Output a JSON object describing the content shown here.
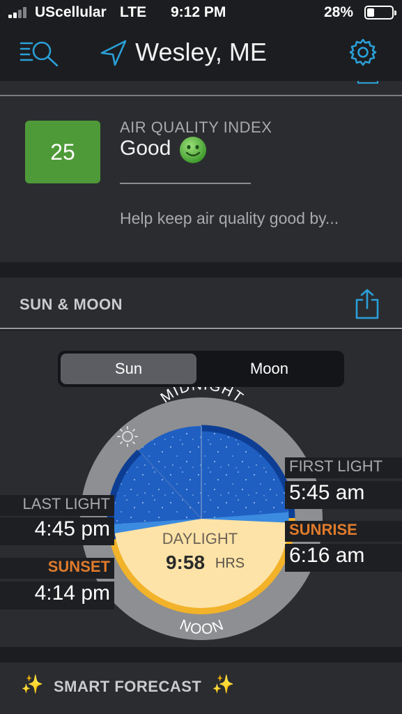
{
  "status_bar": {
    "carrier": "UScellular",
    "network": "LTE",
    "time": "9:12 PM",
    "battery": "28%",
    "battery_level": 0.28
  },
  "nav": {
    "title": "Wesley, ME",
    "icons": [
      "search-menu-icon",
      "location-arrow-icon",
      "gear-icon"
    ],
    "accent_color": "#2aa0d8"
  },
  "aqi": {
    "value": "25",
    "label": "AIR QUALITY INDEX",
    "status": "Good",
    "help_text": "Help keep air quality good by...",
    "badge_color": "#4f9a38"
  },
  "sun_moon": {
    "header": "SUN & MOON",
    "tabs": [
      "Sun",
      "Moon"
    ],
    "selected_tab": "Sun",
    "dial": {
      "top_label": "MIDNIGHT",
      "bottom_label": "NOON",
      "center_label": "DAYLIGHT",
      "center_value": "9:58",
      "center_unit": "HRS"
    },
    "first_light_label": "FIRST LIGHT",
    "first_light_time": "5:45 am",
    "sunrise_label": "SUNRISE",
    "sunrise_time": "6:16 am",
    "last_light_label": "LAST LIGHT",
    "last_light_time": "4:45 pm",
    "sunset_label": "SUNSET",
    "sunset_time": "4:14 pm"
  },
  "smart_forecast": {
    "label": "SMART FORECAST"
  }
}
